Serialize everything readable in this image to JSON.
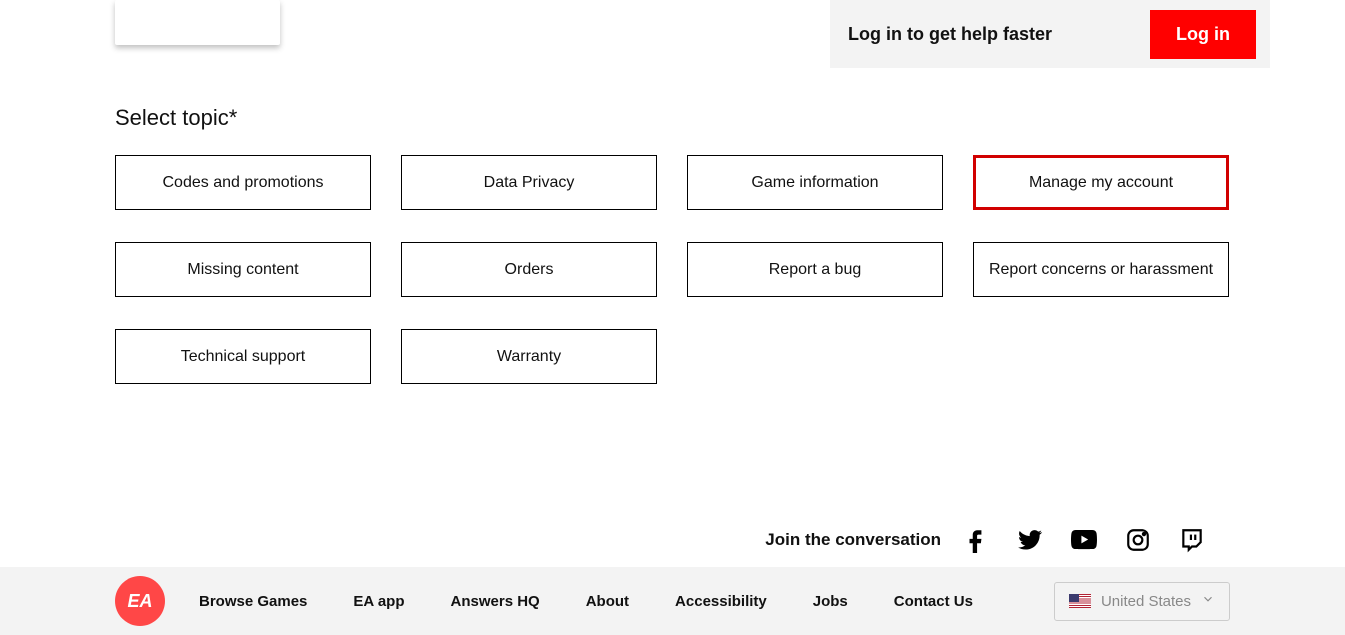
{
  "login_bar": {
    "text": "Log in to get help faster",
    "button": "Log in"
  },
  "heading": "Select topic*",
  "topics": [
    {
      "label": "Codes and promotions",
      "selected": false
    },
    {
      "label": "Data Privacy",
      "selected": false
    },
    {
      "label": "Game information",
      "selected": false
    },
    {
      "label": "Manage my account",
      "selected": true
    },
    {
      "label": "Missing content",
      "selected": false
    },
    {
      "label": "Orders",
      "selected": false
    },
    {
      "label": "Report a bug",
      "selected": false
    },
    {
      "label": "Report concerns or harassment",
      "selected": false
    },
    {
      "label": "Technical support",
      "selected": false
    },
    {
      "label": "Warranty",
      "selected": false
    }
  ],
  "social": {
    "text": "Join the conversation"
  },
  "footer": {
    "logo": "EA",
    "links": [
      "Browse Games",
      "EA app",
      "Answers HQ",
      "About",
      "Accessibility",
      "Jobs",
      "Contact Us"
    ],
    "region": "United States"
  }
}
